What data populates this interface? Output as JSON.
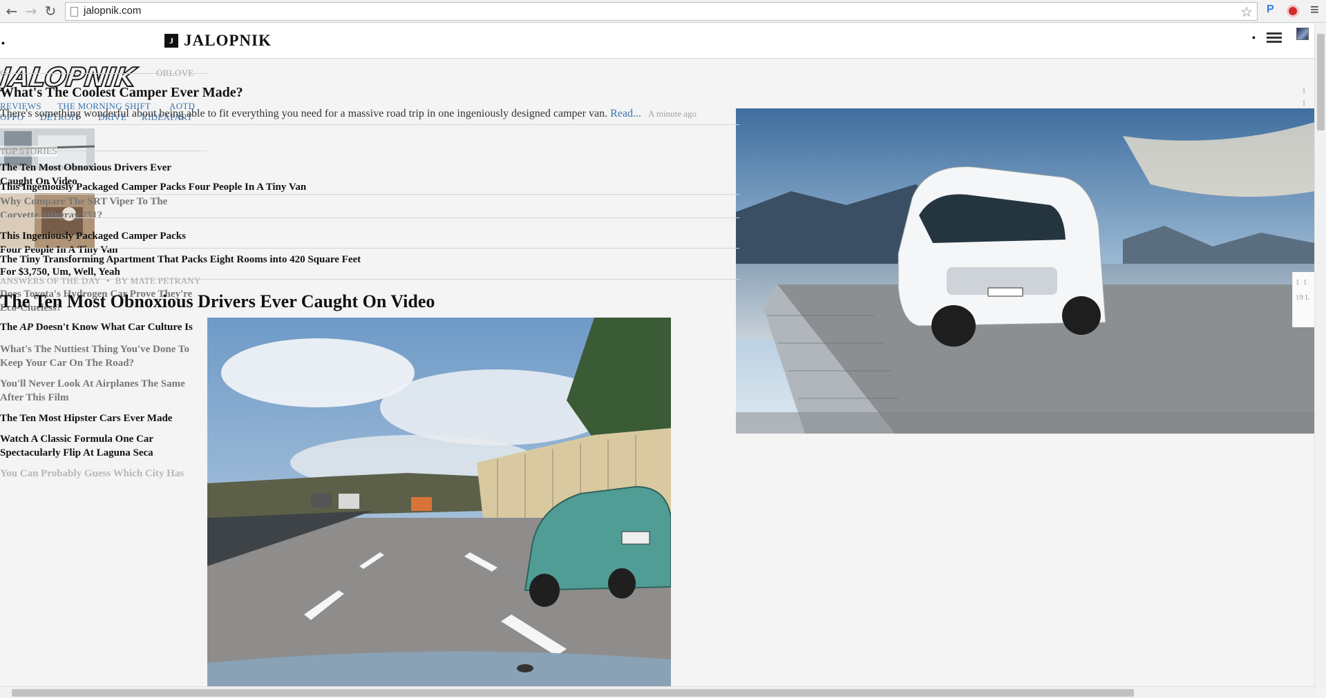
{
  "browser": {
    "back_glyph": "←",
    "forward_glyph": "→",
    "reload_glyph": "↻",
    "url": "jalopnik.com",
    "star_glyph": "☆",
    "ext_p": "P",
    "menu_glyph": "≡"
  },
  "masthead": {
    "dot_left": "•",
    "site_icon": "J",
    "site_name": "JALOPNIK",
    "dot_right": "•"
  },
  "logo": {
    "wordmark": "JALOPNIK"
  },
  "sidebar": {
    "top_labels": [
      "O",
      "ORLOVE"
    ],
    "nav_row1": [
      "REVIEWS",
      "THE MORNING SHIFT",
      "AOTD"
    ],
    "nav_row2": [
      "OPPO",
      "DETROIT",
      "DRIVE",
      "RIDEAPART"
    ],
    "top_stories_label": "TOP STORIES",
    "stories": [
      {
        "text": "The Ten Most Obnoxious Drivers Ever Caught On Video"
      },
      {
        "text": "Why Compare The SRT Viper To The Corvette Stingray 751?"
      },
      {
        "text": "This Ingeniously Packaged Camper Packs Four People In A Tiny Van"
      },
      {
        "text": "For $3,750, Um, Well, Yeah"
      },
      {
        "text": "Does Toyota's Hydrogen Car Prove They're Eco-Clueless?"
      },
      {
        "pre": "The ",
        "em": "AP",
        "post": " Doesn't Know What Car Culture Is"
      },
      {
        "text": "What's The Nuttiest Thing You've Done To Keep Your Car On The Road?"
      },
      {
        "text": "You'll Never Look At Airplanes The Same After This Film"
      },
      {
        "text": "The Ten Most Hipster Cars Ever Made"
      },
      {
        "text": "Watch A Classic Formula One Car Spectacularly Flip At Laguna Seca"
      },
      {
        "text": "You Can Probably Guess Which City Has"
      }
    ]
  },
  "article": {
    "title": "What's The Coolest Camper Ever Made?",
    "excerpt": "There's something wonderful about being able to fit everything you need for a massive road trip in one ingeniously designed camper van.",
    "read_more": "Read...",
    "time": "A minute ago"
  },
  "center_list": [
    "This Ingeniously Packaged Camper Packs Four People In A Tiny Van",
    "The Tiny Transforming Apartment That Packs Eight Rooms into 420 Square Feet"
  ],
  "byline": {
    "category": "ANSWERS OF THE DAY",
    "separator": "•",
    "author": "By MATE PETRANY"
  },
  "feature": {
    "title": "The Ten Most Obnoxious Drivers Ever Caught On Video"
  },
  "right_edge": {
    "top_digits": [
      "1",
      "1"
    ],
    "side_digits_a": [
      "1",
      "1"
    ],
    "side_digits_b": [
      "19",
      "L"
    ]
  }
}
